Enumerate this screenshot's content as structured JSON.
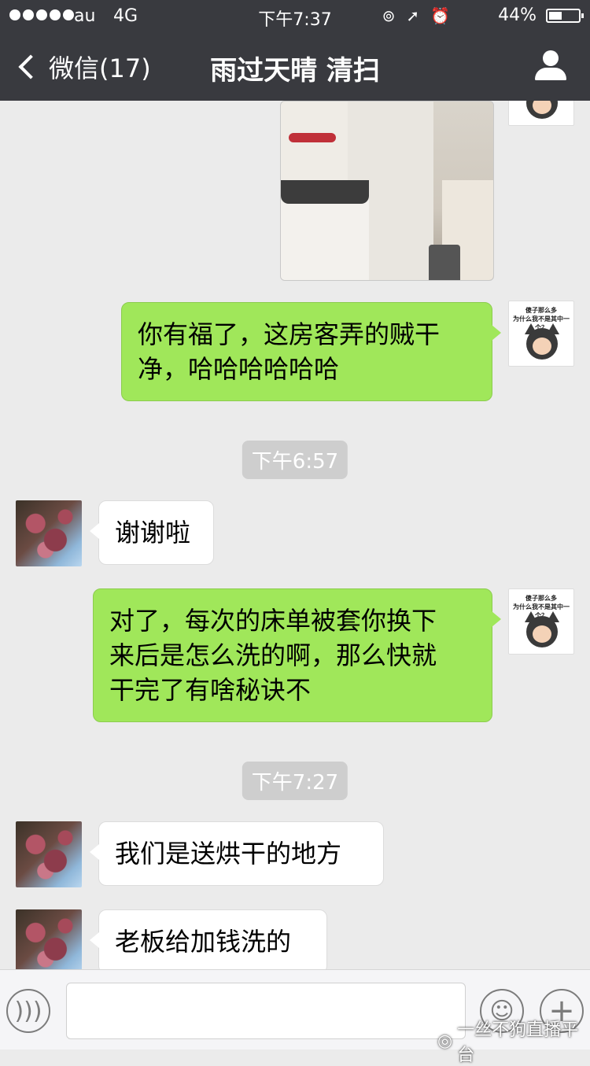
{
  "status_bar": {
    "carrier": "au",
    "network": "4G",
    "time": "下午7:37",
    "battery_percent": "44%",
    "battery_level": 0.44
  },
  "nav": {
    "back_label": "微信(17)",
    "title": "雨过天晴 清扫"
  },
  "messages": {
    "m1": {
      "sender": "me",
      "type": "image"
    },
    "m2": {
      "sender": "me",
      "line1": "你有福了，这房客弄的贼干",
      "line2": "净，哈哈哈哈哈哈"
    },
    "t1": "下午6:57",
    "m3": {
      "sender": "them",
      "text": "谢谢啦"
    },
    "m4": {
      "sender": "me",
      "line1": "对了，每次的床单被套你换下",
      "line2": "来后是怎么洗的啊，那么快就",
      "line3": "干完了有啥秘诀不"
    },
    "t2": "下午7:27",
    "m5": {
      "sender": "them",
      "text": "我们是送烘干的地方"
    },
    "m6": {
      "sender": "them",
      "text": "老板给加钱洗的"
    }
  },
  "my_avatar": {
    "caption_line1": "傻子那么多",
    "caption_line2": "为什么我不是其中一个？"
  },
  "input_bar": {
    "watermark": "一丝不狗直播平台"
  },
  "colors": {
    "nav_bg": "#393a3f",
    "chat_bg": "#ebebeb",
    "outgoing_bubble": "#a0e75a",
    "incoming_bubble": "#ffffff"
  }
}
